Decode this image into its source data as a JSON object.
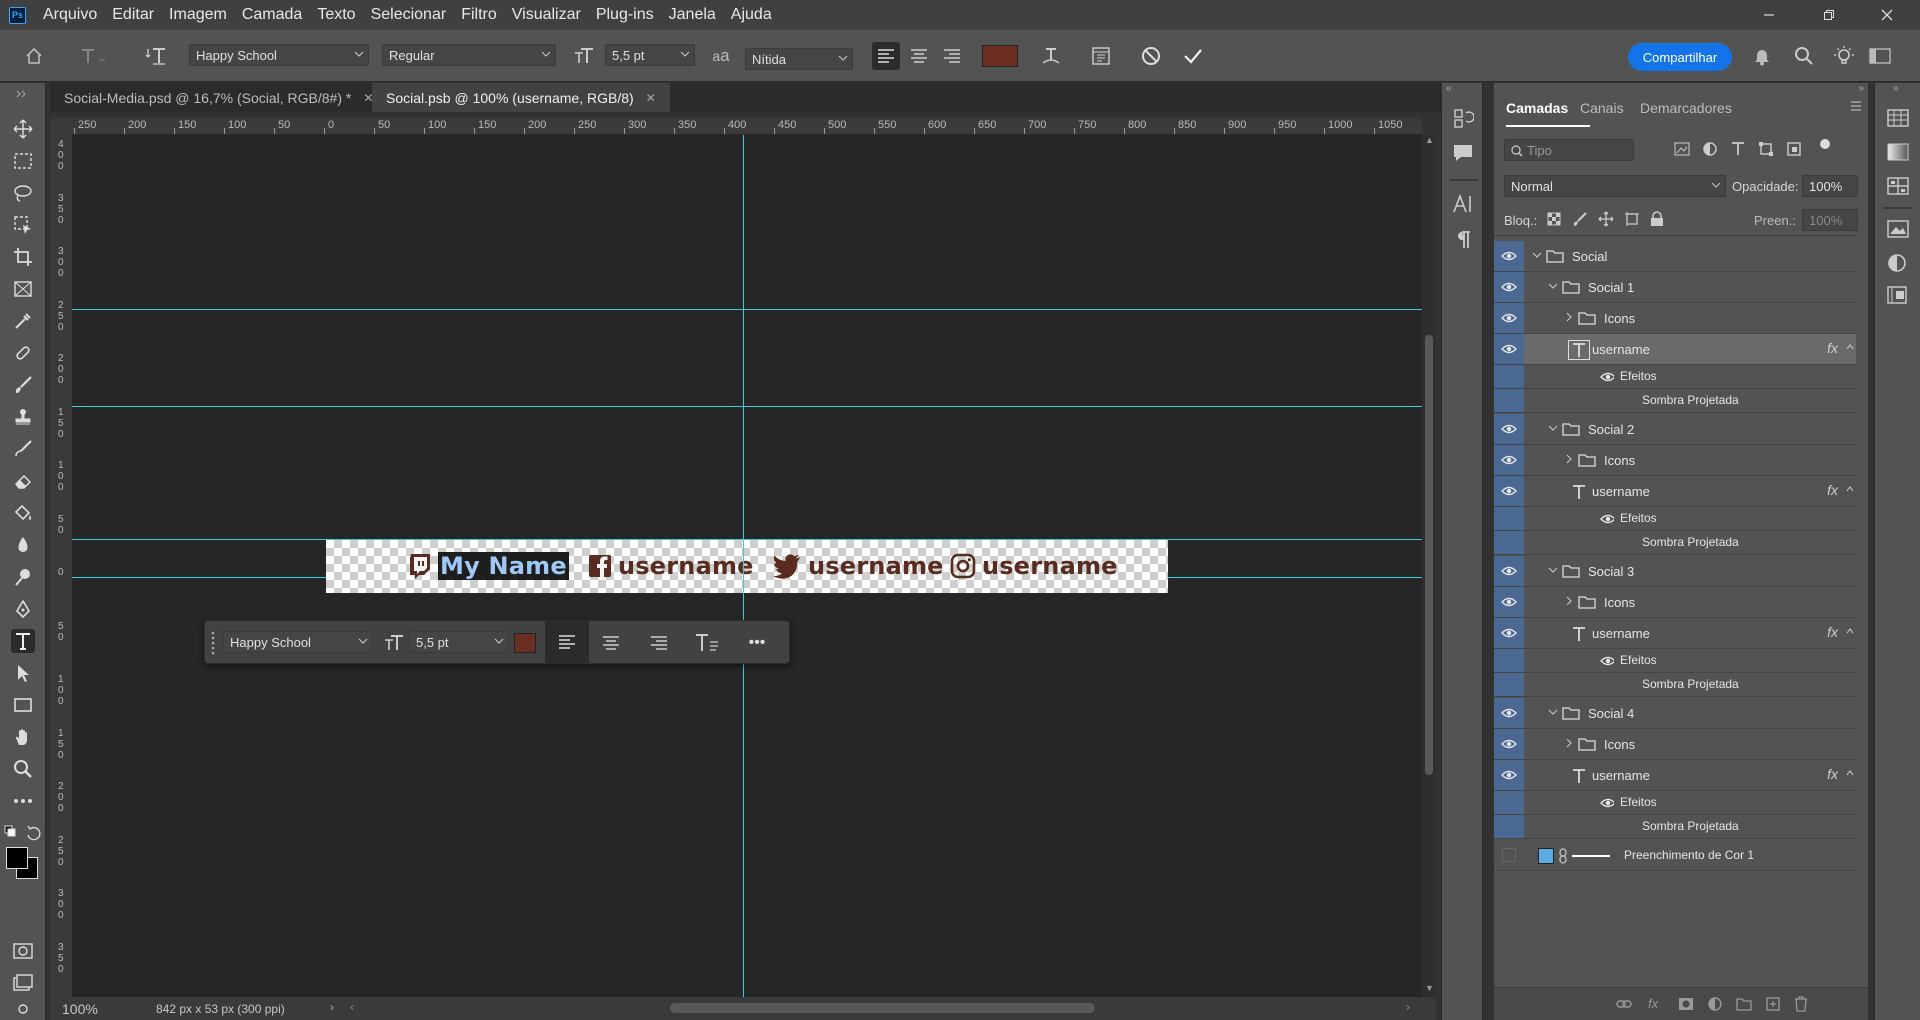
{
  "app": {
    "logo": "Ps"
  },
  "menu": [
    "Arquivo",
    "Editar",
    "Imagem",
    "Camada",
    "Texto",
    "Selecionar",
    "Filtro",
    "Visualizar",
    "Plug-ins",
    "Janela",
    "Ajuda"
  ],
  "options": {
    "font_family": "Happy School",
    "font_style": "Regular",
    "font_size": "5,5 pt",
    "aa_label": "a",
    "antialias": "Nítida",
    "color": "#6b2e22",
    "share": "Compartilhar"
  },
  "tabs": [
    {
      "label": "Social-Media.psd @ 16,7% (Social, RGB/8#) *"
    },
    {
      "label": "Social.psb @ 100% (username, RGB/8)"
    }
  ],
  "ruler": {
    "h": [
      "250",
      "200",
      "150",
      "100",
      "50",
      "0",
      "50",
      "100",
      "150",
      "200",
      "250",
      "300",
      "350",
      "400",
      "450",
      "500",
      "550",
      "600",
      "650",
      "700",
      "750",
      "800",
      "850",
      "900",
      "950",
      "1000",
      "1050"
    ],
    "v": [
      "4 0 0",
      "3 5 0",
      "3 0 0",
      "2 5 0",
      "2 0 0",
      "1 5 0",
      "1 0 0",
      "5 0",
      "0",
      "5 0",
      "1 0 0",
      "1 5 0",
      "2 0 0",
      "2 5 0",
      "3 0 0",
      "3 5 0"
    ]
  },
  "document": {
    "items": [
      {
        "icon": "twitch-icon",
        "text": "My Name",
        "selected": true
      },
      {
        "icon": "facebook-icon",
        "text": "username"
      },
      {
        "icon": "twitter-icon",
        "text": "username"
      },
      {
        "icon": "instagram-icon",
        "text": "username"
      }
    ]
  },
  "context_bar": {
    "font_family": "Happy School",
    "font_size": "5,5 pt",
    "more": "•••"
  },
  "status": {
    "zoom": "100%",
    "info": "842 px x 53 px (300 ppi)"
  },
  "layers_panel": {
    "tabs": [
      "Camadas",
      "Canais",
      "Demarcadores"
    ],
    "search_placeholder": "Tipo",
    "blend_mode": "Normal",
    "opacity_label": "Opacidade:",
    "opacity": "100%",
    "lock_label": "Bloq.:",
    "fill_label": "Preen.:",
    "fill": "100%",
    "rows": [
      {
        "type": "group",
        "name": "Social",
        "indent": 0,
        "open": true
      },
      {
        "type": "group",
        "name": "Social 1",
        "indent": 1,
        "open": true
      },
      {
        "type": "group",
        "name": "Icons",
        "indent": 2,
        "open": false
      },
      {
        "type": "text",
        "name": "username",
        "indent": 2,
        "fx": "fx",
        "selected": true
      },
      {
        "type": "effects",
        "name": "Efeitos"
      },
      {
        "type": "effect",
        "name": "Sombra Projetada"
      },
      {
        "type": "group",
        "name": "Social 2",
        "indent": 1,
        "open": true
      },
      {
        "type": "group",
        "name": "Icons",
        "indent": 2,
        "open": false
      },
      {
        "type": "text",
        "name": "username",
        "indent": 2,
        "fx": "fx"
      },
      {
        "type": "effects",
        "name": "Efeitos"
      },
      {
        "type": "effect",
        "name": "Sombra Projetada"
      },
      {
        "type": "group",
        "name": "Social 3",
        "indent": 1,
        "open": true
      },
      {
        "type": "group",
        "name": "Icons",
        "indent": 2,
        "open": false
      },
      {
        "type": "text",
        "name": "username",
        "indent": 2,
        "fx": "fx"
      },
      {
        "type": "effects",
        "name": "Efeitos"
      },
      {
        "type": "effect",
        "name": "Sombra Projetada"
      },
      {
        "type": "group",
        "name": "Social 4",
        "indent": 1,
        "open": true
      },
      {
        "type": "group",
        "name": "Icons",
        "indent": 2,
        "open": false
      },
      {
        "type": "text",
        "name": "username",
        "indent": 2,
        "fx": "fx"
      },
      {
        "type": "effects",
        "name": "Efeitos"
      },
      {
        "type": "effect",
        "name": "Sombra Projetada"
      },
      {
        "type": "fill",
        "name": "Preenchimento de Cor 1",
        "color": "#5aaee8"
      }
    ]
  }
}
